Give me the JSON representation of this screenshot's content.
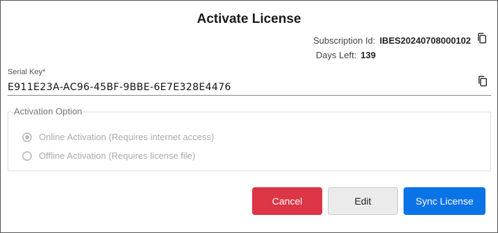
{
  "dialog": {
    "title": "Activate License",
    "subscription": {
      "label": "Subscription Id:",
      "value": "IBES20240708000102",
      "copy_icon": "copy-icon"
    },
    "days_left": {
      "label": "Days Left:",
      "value": "139"
    },
    "serial_key": {
      "label": "Serial Key*",
      "value": "E911E23A-AC96-45BF-9BBE-6E7E328E4476",
      "copy_icon": "copy-icon"
    },
    "activation": {
      "legend": "Activation Option",
      "options": [
        {
          "label": "Online Activation (Requires internet access)",
          "checked": true,
          "disabled": true
        },
        {
          "label": "Offline Activation (Requires license file)",
          "checked": false,
          "disabled": true
        }
      ]
    },
    "buttons": {
      "cancel": "Cancel",
      "edit": "Edit",
      "sync": "Sync License"
    },
    "colors": {
      "cancel": "#dc3545",
      "edit": "#ebebeb",
      "sync": "#0b73e8"
    }
  }
}
